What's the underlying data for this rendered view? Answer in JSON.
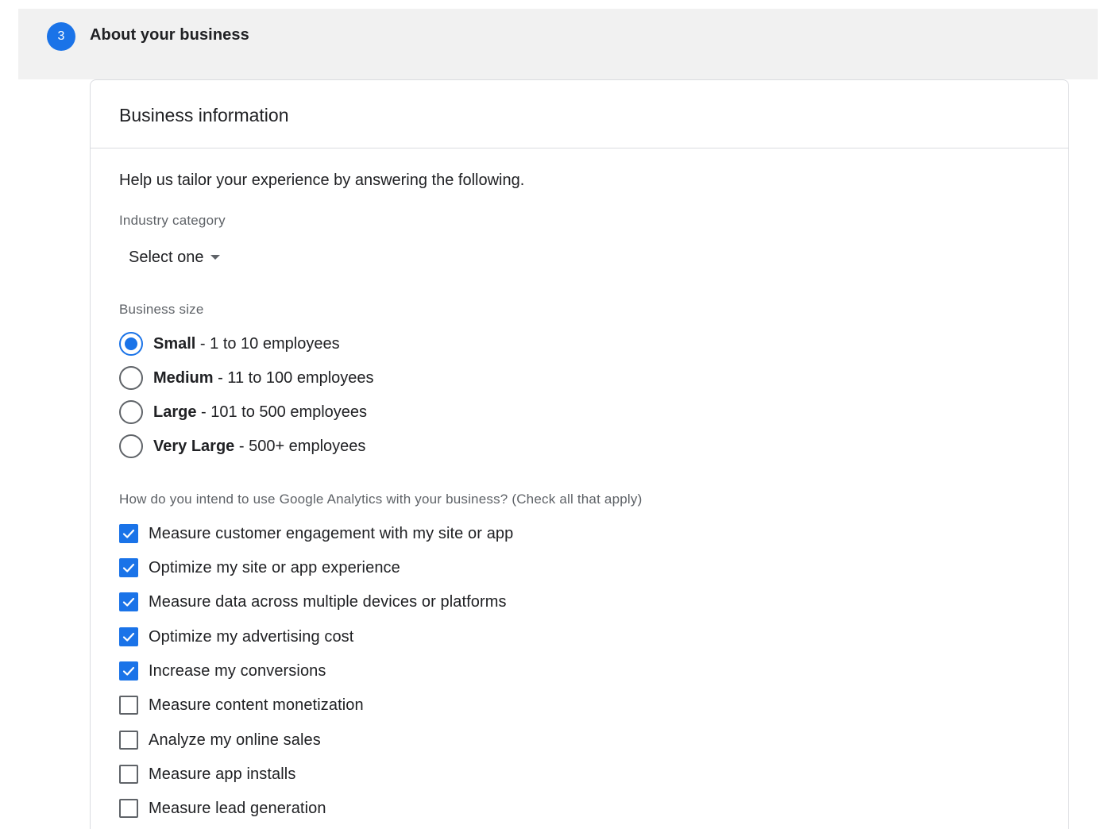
{
  "step": {
    "number": "3",
    "title": "About your business"
  },
  "card": {
    "title": "Business information",
    "intro": "Help us tailor your experience by answering the following.",
    "industry": {
      "label": "Industry category",
      "selected": "Select one"
    },
    "size": {
      "label": "Business size",
      "options": [
        {
          "bold": "Small",
          "rest": " - 1 to 10 employees",
          "checked": true
        },
        {
          "bold": "Medium",
          "rest": " - 11 to 100 employees",
          "checked": false
        },
        {
          "bold": "Large",
          "rest": " - 101 to 500 employees",
          "checked": false
        },
        {
          "bold": "Very Large",
          "rest": " - 500+ employees",
          "checked": false
        }
      ]
    },
    "usage": {
      "label": "How do you intend to use Google Analytics with your business? (Check all that apply)",
      "options": [
        {
          "label": "Measure customer engagement with my site or app",
          "checked": true
        },
        {
          "label": "Optimize my site or app experience",
          "checked": true
        },
        {
          "label": "Measure data across multiple devices or platforms",
          "checked": true
        },
        {
          "label": "Optimize my advertising cost",
          "checked": true
        },
        {
          "label": "Increase my conversions",
          "checked": true
        },
        {
          "label": "Measure content monetization",
          "checked": false
        },
        {
          "label": "Analyze my online sales",
          "checked": false
        },
        {
          "label": "Measure app installs",
          "checked": false
        },
        {
          "label": "Measure lead generation",
          "checked": false
        }
      ]
    }
  },
  "colors": {
    "accent": "#1a73e8",
    "header_bg": "#f1f1f1",
    "border": "#dadce0"
  }
}
